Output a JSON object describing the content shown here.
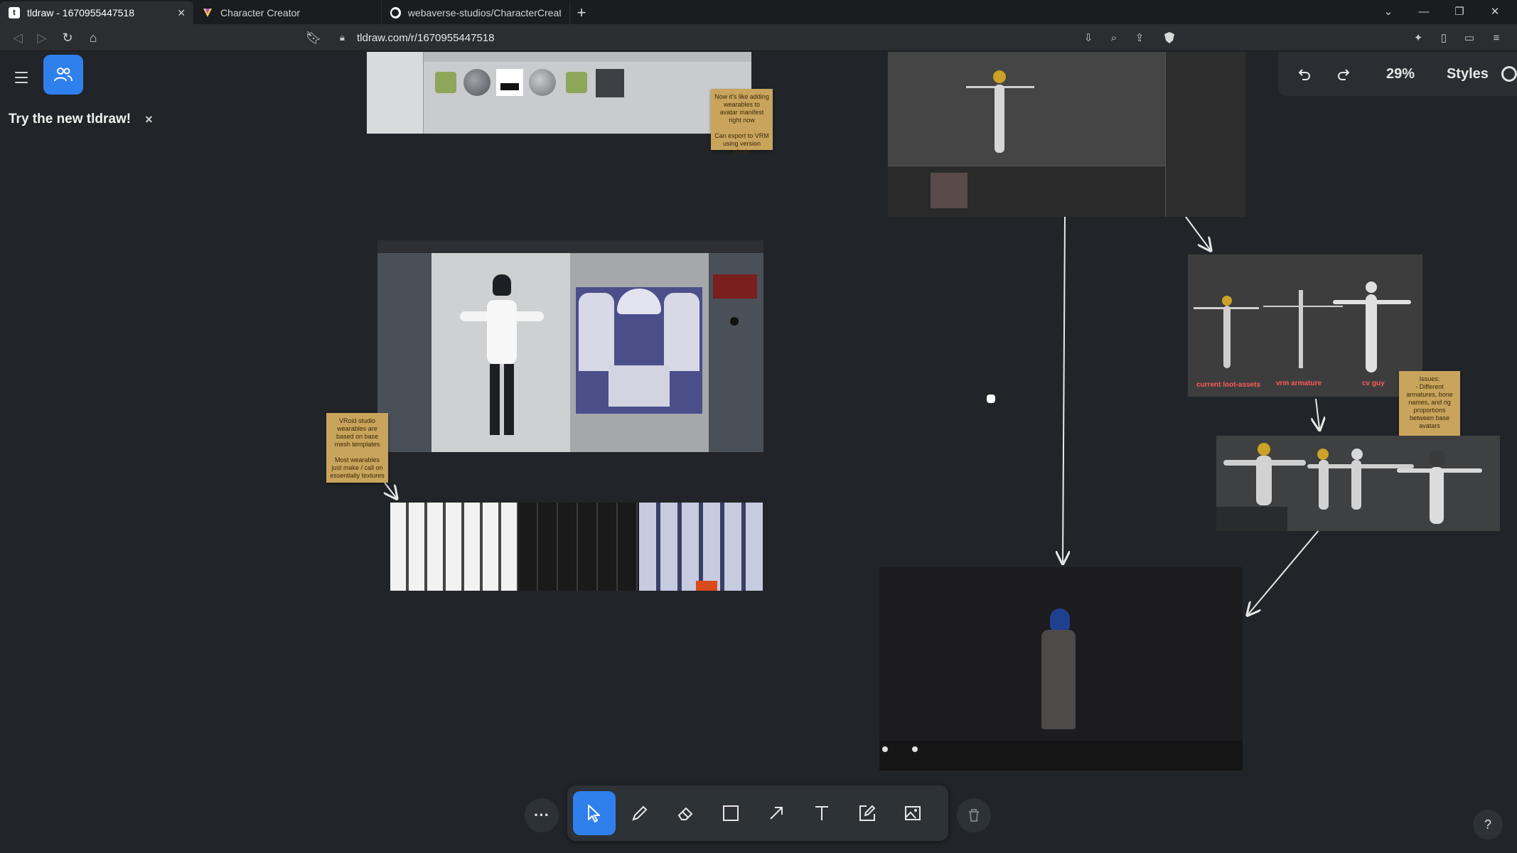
{
  "browser": {
    "tabs": [
      {
        "title": "tldraw - 1670955447518",
        "active": true,
        "favicon": "tldraw-icon"
      },
      {
        "title": "Character Creator",
        "active": false,
        "favicon": "character-creator-icon"
      },
      {
        "title": "webaverse-studios/CharacterCreator:",
        "active": false,
        "favicon": "github-icon"
      }
    ],
    "new_tab": "+",
    "url": "tldraw.com/r/1670955447518"
  },
  "app": {
    "promo_text": "Try the new tldraw!",
    "promo_close": "×",
    "zoom_level": "29%",
    "styles_label": "Styles",
    "help_label": "?",
    "more_label": "···"
  },
  "canvas": {
    "note_vroid": "VRoid studio wearables are based on base mesh templates\n\nMost wearables just make / call on essentially textures",
    "note_blender": "Now it's like adding wearables to avatar manifest right now\n\nCan export to VRM using version plugin",
    "note_issues": "Issues:\n- Different armatures, bone names, and rig proportions between base avatars",
    "label_current": "current loot-assets",
    "label_vrm": "vrm armature",
    "label_cv": "cv guy"
  },
  "colors": {
    "canvas_bg": "#212529",
    "accent": "#2f80ed",
    "note": "#c9a45c",
    "label_red": "#ff5a5a"
  }
}
